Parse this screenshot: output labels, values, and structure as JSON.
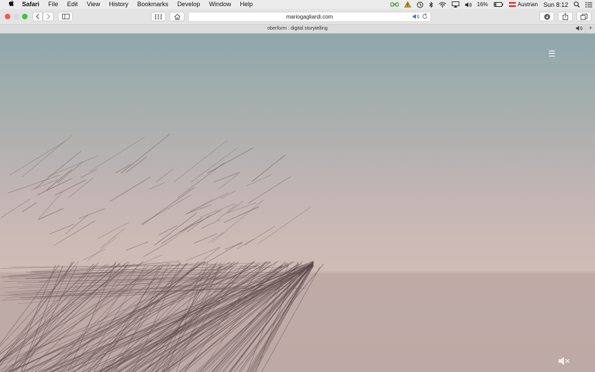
{
  "menubar": {
    "app_name": "Safari",
    "items": [
      "File",
      "Edit",
      "View",
      "History",
      "Bookmarks",
      "Develop",
      "Window",
      "Help"
    ],
    "battery": "16%",
    "input_source": "Austrian",
    "clock": "Sun 8:12"
  },
  "toolbar": {
    "url": "mariogagliardi.com"
  },
  "tab": {
    "title": "oberform : digital storytelling"
  },
  "page": {
    "menu_glyph": "☰"
  }
}
